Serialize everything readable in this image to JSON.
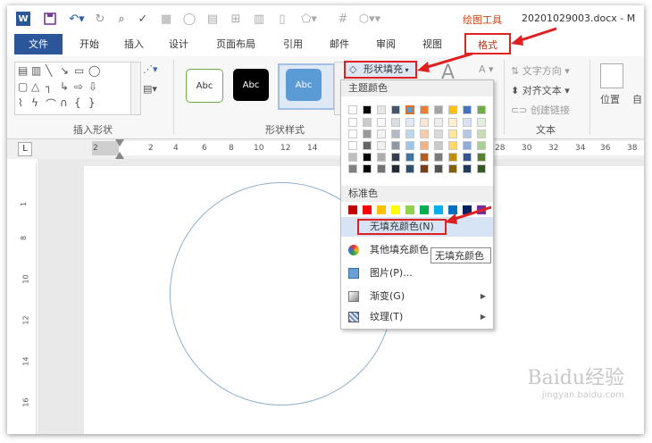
{
  "titlebar": {
    "context_tool": "绘图工具",
    "document_title": "20201029003.docx - M"
  },
  "tabs": {
    "file": "文件",
    "items": [
      "开始",
      "插入",
      "设计",
      "页面布局",
      "引用",
      "邮件",
      "审阅",
      "视图"
    ],
    "format": "格式"
  },
  "ribbon": {
    "insert_shapes_label": "插入形状",
    "shape_styles_label": "形状样式",
    "style_sample": "Abc",
    "shape_fill": "形状填充",
    "text_direction": "文字方向",
    "align_text": "对齐文本",
    "create_link": "创建链接",
    "text_label": "文本",
    "position": "位置",
    "wrap_first_char": "自"
  },
  "ruler": {
    "corner": "L",
    "top_numbers": [
      "2",
      "2",
      "4",
      "6",
      "8",
      "10",
      "12",
      "14",
      "28",
      "30",
      "32",
      "34",
      "36",
      "38"
    ],
    "side_numbers": [
      "1",
      "8",
      "10",
      "12",
      "14",
      "16"
    ]
  },
  "fill_menu": {
    "theme_colors_label": "主题颜色",
    "standard_colors_label": "标准色",
    "no_fill": "无填充颜色(N)",
    "more_colors": "其他填充颜色",
    "picture": "图片(P)...",
    "gradient": "渐变(G)",
    "texture": "纹理(T)",
    "tooltip": "无填充颜色",
    "theme_colors": [
      "#ffffff",
      "#000000",
      "#e7e6e6",
      "#44546a",
      "#5b9bd5",
      "#ed7d31",
      "#a5a5a5",
      "#ffc000",
      "#4472c4",
      "#70ad47"
    ],
    "standard_colors": [
      "#c00000",
      "#ff0000",
      "#ffc000",
      "#ffff00",
      "#92d050",
      "#00b050",
      "#00b0f0",
      "#0070c0",
      "#002060",
      "#7030a0"
    ]
  },
  "watermark": {
    "brand": "Baidu经验",
    "url": "jingyan.baidu.com"
  },
  "colors": {
    "accent_blue": "#2b579a",
    "highlight_red": "#e02020",
    "context_orange": "#d04010"
  }
}
